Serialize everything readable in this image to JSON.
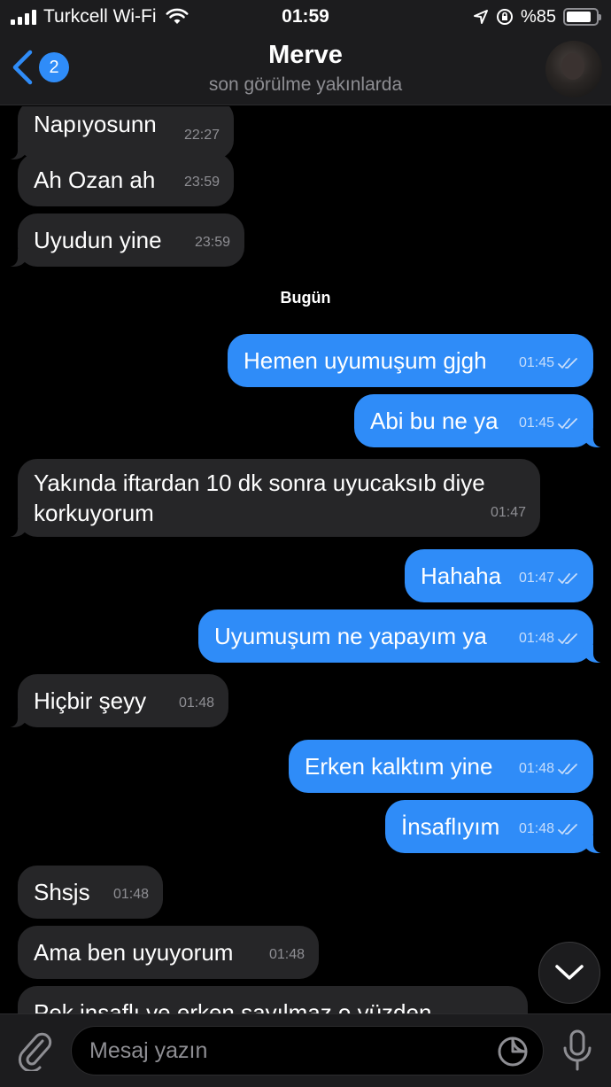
{
  "status_bar": {
    "carrier": "Turkcell Wi-Fi",
    "time": "01:59",
    "battery_text": "%85",
    "battery_level": 0.85
  },
  "header": {
    "unread_count": "2",
    "title": "Merve",
    "subtitle": "son görülme yakınlarda",
    "accent_color": "#2f8cf8"
  },
  "messages": [
    {
      "text": "Napıyosunn",
      "time": "22:27",
      "dir": "in"
    },
    {
      "text": "Ah Ozan ah",
      "time": "23:59",
      "dir": "in"
    },
    {
      "text": "Uyudun yine",
      "time": "23:59",
      "dir": "in"
    },
    {
      "text": "Hemen uyumuşum gjgh",
      "time": "01:45",
      "dir": "out"
    },
    {
      "text": "Abi bu ne ya",
      "time": "01:45",
      "dir": "out"
    },
    {
      "text": "Yakında iftardan 10 dk sonra uyucaksıb diye",
      "text2": "korkuyorum",
      "time": "01:47",
      "dir": "in"
    },
    {
      "text": "Hahaha",
      "time": "01:47",
      "dir": "out"
    },
    {
      "text": "Uyumuşum ne yapayım ya",
      "time": "01:48",
      "dir": "out"
    },
    {
      "text": "Hiçbir şeyy",
      "time": "01:48",
      "dir": "in"
    },
    {
      "text": "Erken kalktım yine",
      "time": "01:48",
      "dir": "out"
    },
    {
      "text": "İnsaflıyım",
      "time": "01:48",
      "dir": "out"
    },
    {
      "text": "Shsjs",
      "time": "01:48",
      "dir": "in"
    },
    {
      "text": "Ama ben uyuyorum",
      "time": "01:48",
      "dir": "in"
    },
    {
      "text": "Pek insaflı ve erken sayılmaz o yüzden",
      "time": "",
      "dir": "in"
    }
  ],
  "date_separator": "Bugün",
  "input": {
    "placeholder": "Mesaj yazın",
    "value": ""
  },
  "colors": {
    "outgoing_bubble": "#2f8cf8",
    "incoming_bubble": "#262628",
    "background": "#000000"
  }
}
